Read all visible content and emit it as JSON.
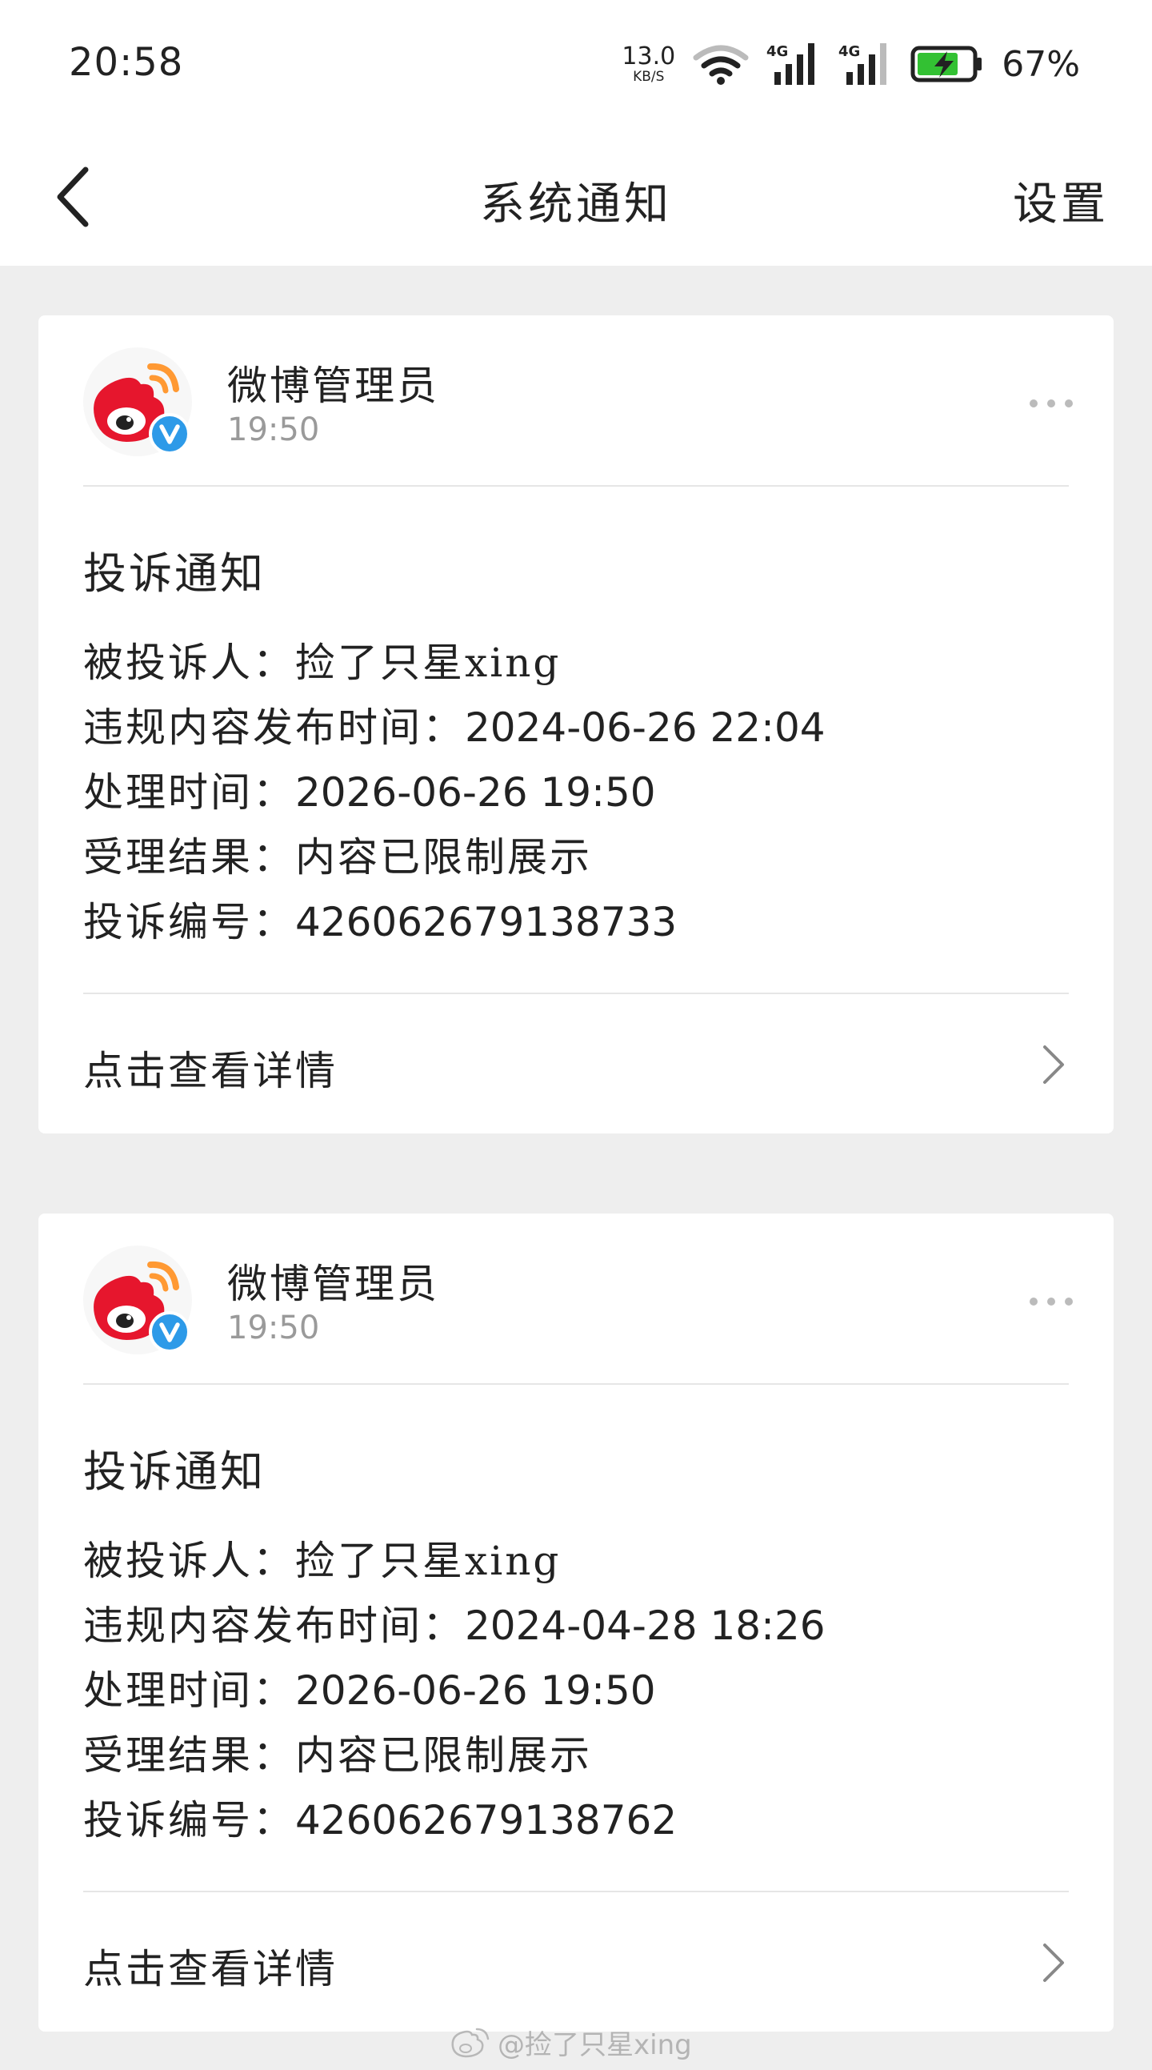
{
  "status_bar": {
    "time": "20:58",
    "net_speed_value": "13.0",
    "net_speed_unit": "KB/S",
    "signal_1_label": "4G",
    "signal_2_label": "4G",
    "battery_percent": "67%"
  },
  "header": {
    "title": "系统通知",
    "settings_label": "设置",
    "back_icon": "chevron-left-icon"
  },
  "colors": {
    "background": "#eeeeee",
    "card": "#ffffff",
    "weibo_red": "#e6162d",
    "weibo_orange": "#ff9933",
    "verified_blue": "#2d9ae8",
    "battery_green": "#33c133",
    "muted_text": "#9a9a9a"
  },
  "notifications": [
    {
      "sender": "微博管理员",
      "time": "19:50",
      "title": "投诉通知",
      "fields": {
        "complainee_label": "被投诉人：",
        "complainee_value": "捡了只星xing",
        "publish_time_label": "违规内容发布时间：",
        "publish_time_value": "2024-06-26 22:04",
        "process_time_label": "处理时间：",
        "process_time_value": "2026-06-26 19:50",
        "result_label": "受理结果：",
        "result_value": "内容已限制展示",
        "complaint_no_label": "投诉编号：",
        "complaint_no_value": "426062679138733"
      },
      "details_label": "点击查看详情"
    },
    {
      "sender": "微博管理员",
      "time": "19:50",
      "title": "投诉通知",
      "fields": {
        "complainee_label": "被投诉人：",
        "complainee_value": "捡了只星xing",
        "publish_time_label": "违规内容发布时间：",
        "publish_time_value": "2024-04-28 18:26",
        "process_time_label": "处理时间：",
        "process_time_value": "2026-06-26 19:50",
        "result_label": "受理结果：",
        "result_value": "内容已限制展示",
        "complaint_no_label": "投诉编号：",
        "complaint_no_value": "426062679138762"
      },
      "details_label": "点击查看详情"
    }
  ],
  "watermark": "@捡了只星xing"
}
